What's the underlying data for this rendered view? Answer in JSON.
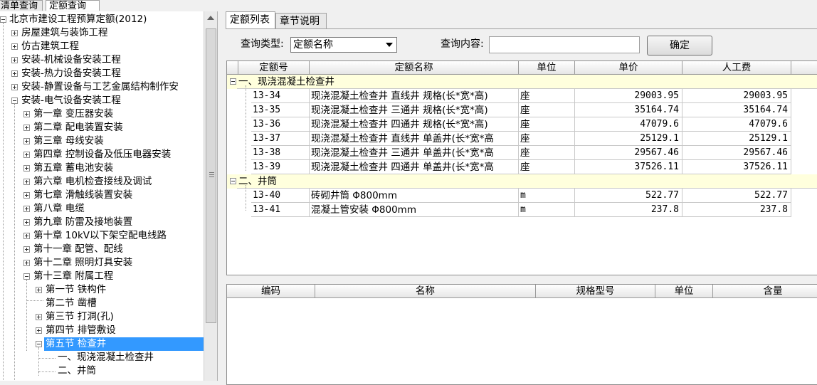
{
  "top_tabs": [
    "清单查询",
    "定额查询"
  ],
  "tree": {
    "root": "北京市建设工程预算定额(2012)",
    "items": [
      "房屋建筑与装饰工程",
      "仿古建筑工程",
      "安装-机械设备安装工程",
      "安装-热力设备安装工程",
      "安装-静置设备与工艺金属结构制作安",
      "安装-电气设备安装工程"
    ],
    "chapters": [
      "第一章  变压器安装",
      "第二章  配电装置安装",
      "第三章  母线安装",
      "第四章  控制设备及低压电器安装",
      "第五章  蓄电池安装",
      "第六章  电机检查接线及调试",
      "第七章  滑触线装置安装",
      "第八章  电缆",
      "第九章  防雷及接地装置",
      "第十章  10kV以下架空配电线路",
      "第十一章  配管、配线",
      "第十二章  照明灯具安装",
      "第十三章  附属工程"
    ],
    "sections": [
      "第一节  铁构件",
      "第二节  凿槽",
      "第三节  打洞(孔)",
      "第四节  排管敷设",
      "第五节  检查井"
    ],
    "subsections": [
      "一、现浇混凝土检查井",
      "二、井筒"
    ]
  },
  "right_tabs": [
    "定额列表",
    "章节说明"
  ],
  "query": {
    "type_label": "查询类型:",
    "type_value": "定额名称",
    "content_label": "查询内容:",
    "content_value": "",
    "confirm": "确定"
  },
  "grid": {
    "headers": [
      "定额号",
      "定额名称",
      "单位",
      "单价",
      "人工费"
    ],
    "groups": [
      {
        "title": "一、现浇混凝土检查井",
        "rows": [
          {
            "code": "13-34",
            "name": "现浇混凝土检查井 直线井 规格(长*宽*高)",
            "unit": "座",
            "price": "29003.95",
            "labor": "29003.95"
          },
          {
            "code": "13-35",
            "name": "现浇混凝土检查井 三通井 规格(长*宽*高)",
            "unit": "座",
            "price": "35164.74",
            "labor": "35164.74"
          },
          {
            "code": "13-36",
            "name": "现浇混凝土检查井 四通井 规格(长*宽*高)",
            "unit": "座",
            "price": "47079.6",
            "labor": "47079.6"
          },
          {
            "code": "13-37",
            "name": "现浇混凝土检查井 直线井 单盖井(长*宽*高",
            "unit": "座",
            "price": "25129.1",
            "labor": "25129.1"
          },
          {
            "code": "13-38",
            "name": "现浇混凝土检查井 三通井 单盖井(长*宽*高",
            "unit": "座",
            "price": "29567.46",
            "labor": "29567.46"
          },
          {
            "code": "13-39",
            "name": "现浇混凝土检查井 四通井 单盖井(长*宽*高",
            "unit": "座",
            "price": "37526.11",
            "labor": "37526.11"
          }
        ]
      },
      {
        "title": "二、井筒",
        "rows": [
          {
            "code": "13-40",
            "name": "砖砌井筒 Φ800mm",
            "unit": "m",
            "price": "522.77",
            "labor": "522.77"
          },
          {
            "code": "13-41",
            "name": "混凝土管安装 Φ800mm",
            "unit": "m",
            "price": "237.8",
            "labor": "237.8"
          }
        ]
      }
    ]
  },
  "detail_grid": {
    "headers": [
      "编码",
      "名称",
      "规格型号",
      "单位",
      "含量"
    ]
  },
  "colors": {
    "selection": "#3399ff",
    "group_row": "#ffffdd"
  }
}
